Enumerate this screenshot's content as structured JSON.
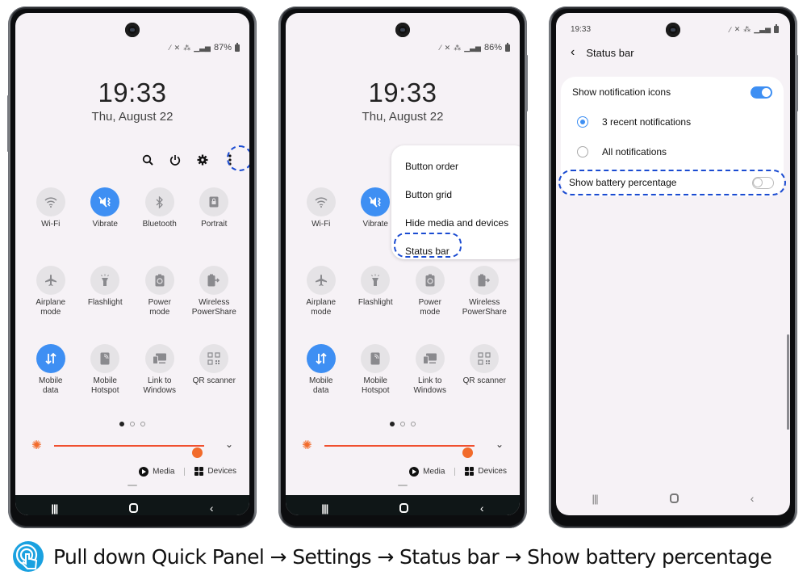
{
  "phones": [
    {
      "id": "phone-1",
      "battery": "87%",
      "clock": "19:33",
      "date": "Thu, August 22",
      "toolbar_icons": [
        "search-icon",
        "power-icon",
        "gear-icon",
        "more-vert-icon"
      ],
      "highlighted": "more-vert-icon"
    },
    {
      "id": "phone-2",
      "battery": "86%",
      "clock": "19:33",
      "date": "Thu, August 22",
      "menu": {
        "items": [
          "Button order",
          "Button grid",
          "Hide media and devices",
          "Status bar"
        ],
        "highlighted": "Status bar"
      }
    },
    {
      "id": "phone-3",
      "time": "19:33",
      "header_title": "Status bar",
      "settings": {
        "show_notification_icons": {
          "label": "Show notification icons",
          "enabled": true
        },
        "options": [
          {
            "label": "3 recent notifications",
            "selected": true
          },
          {
            "label": "All notifications",
            "selected": false
          }
        ],
        "show_battery_percentage": {
          "label": "Show battery percentage",
          "enabled": false
        }
      }
    }
  ],
  "quick_tiles": [
    {
      "label": "Wi-Fi",
      "icon": "wifi-icon",
      "on": false
    },
    {
      "label": "Vibrate",
      "icon": "vibrate-icon",
      "on": true
    },
    {
      "label": "Bluetooth",
      "icon": "bluetooth-icon",
      "on": false
    },
    {
      "label": "Portrait",
      "icon": "portrait-lock-icon",
      "on": false
    },
    {
      "label": "Airplane\nmode",
      "icon": "airplane-icon",
      "on": false
    },
    {
      "label": "Flashlight",
      "icon": "flashlight-icon",
      "on": false
    },
    {
      "label": "Power\nmode",
      "icon": "power-mode-icon",
      "on": false
    },
    {
      "label": "Wireless\nPowerShare",
      "icon": "wireless-powershare-icon",
      "on": false
    },
    {
      "label": "Mobile\ndata",
      "icon": "mobile-data-icon",
      "on": true
    },
    {
      "label": "Mobile\nHotspot",
      "icon": "hotspot-icon",
      "on": false
    },
    {
      "label": "Link to\nWindows",
      "icon": "link-to-windows-icon",
      "on": false
    },
    {
      "label": "QR scanner",
      "icon": "qr-scanner-icon",
      "on": false
    }
  ],
  "quick_panel": {
    "page_count": 3,
    "active_page": 1,
    "brightness_percent": 95,
    "media_label": "Media",
    "devices_label": "Devices"
  },
  "caption": "Pull down Quick Panel → Settings → Status bar → Show battery percentage",
  "colors": {
    "accent": "#3e8ff3",
    "highlight_dash": "#1a4bd1",
    "brightness": "#f26b2b"
  }
}
